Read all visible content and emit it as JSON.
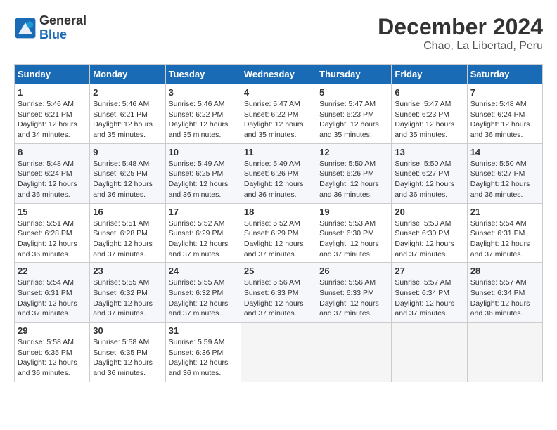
{
  "header": {
    "logo_line1": "General",
    "logo_line2": "Blue",
    "title": "December 2024",
    "subtitle": "Chao, La Libertad, Peru"
  },
  "calendar": {
    "weekdays": [
      "Sunday",
      "Monday",
      "Tuesday",
      "Wednesday",
      "Thursday",
      "Friday",
      "Saturday"
    ],
    "weeks": [
      [
        {
          "day": 1,
          "sunrise": "5:46 AM",
          "sunset": "6:21 PM",
          "daylight": "12 hours and 34 minutes."
        },
        {
          "day": 2,
          "sunrise": "5:46 AM",
          "sunset": "6:21 PM",
          "daylight": "12 hours and 35 minutes."
        },
        {
          "day": 3,
          "sunrise": "5:46 AM",
          "sunset": "6:22 PM",
          "daylight": "12 hours and 35 minutes."
        },
        {
          "day": 4,
          "sunrise": "5:47 AM",
          "sunset": "6:22 PM",
          "daylight": "12 hours and 35 minutes."
        },
        {
          "day": 5,
          "sunrise": "5:47 AM",
          "sunset": "6:23 PM",
          "daylight": "12 hours and 35 minutes."
        },
        {
          "day": 6,
          "sunrise": "5:47 AM",
          "sunset": "6:23 PM",
          "daylight": "12 hours and 35 minutes."
        },
        {
          "day": 7,
          "sunrise": "5:48 AM",
          "sunset": "6:24 PM",
          "daylight": "12 hours and 36 minutes."
        }
      ],
      [
        {
          "day": 8,
          "sunrise": "5:48 AM",
          "sunset": "6:24 PM",
          "daylight": "12 hours and 36 minutes."
        },
        {
          "day": 9,
          "sunrise": "5:48 AM",
          "sunset": "6:25 PM",
          "daylight": "12 hours and 36 minutes."
        },
        {
          "day": 10,
          "sunrise": "5:49 AM",
          "sunset": "6:25 PM",
          "daylight": "12 hours and 36 minutes."
        },
        {
          "day": 11,
          "sunrise": "5:49 AM",
          "sunset": "6:26 PM",
          "daylight": "12 hours and 36 minutes."
        },
        {
          "day": 12,
          "sunrise": "5:50 AM",
          "sunset": "6:26 PM",
          "daylight": "12 hours and 36 minutes."
        },
        {
          "day": 13,
          "sunrise": "5:50 AM",
          "sunset": "6:27 PM",
          "daylight": "12 hours and 36 minutes."
        },
        {
          "day": 14,
          "sunrise": "5:50 AM",
          "sunset": "6:27 PM",
          "daylight": "12 hours and 36 minutes."
        }
      ],
      [
        {
          "day": 15,
          "sunrise": "5:51 AM",
          "sunset": "6:28 PM",
          "daylight": "12 hours and 36 minutes."
        },
        {
          "day": 16,
          "sunrise": "5:51 AM",
          "sunset": "6:28 PM",
          "daylight": "12 hours and 37 minutes."
        },
        {
          "day": 17,
          "sunrise": "5:52 AM",
          "sunset": "6:29 PM",
          "daylight": "12 hours and 37 minutes."
        },
        {
          "day": 18,
          "sunrise": "5:52 AM",
          "sunset": "6:29 PM",
          "daylight": "12 hours and 37 minutes."
        },
        {
          "day": 19,
          "sunrise": "5:53 AM",
          "sunset": "6:30 PM",
          "daylight": "12 hours and 37 minutes."
        },
        {
          "day": 20,
          "sunrise": "5:53 AM",
          "sunset": "6:30 PM",
          "daylight": "12 hours and 37 minutes."
        },
        {
          "day": 21,
          "sunrise": "5:54 AM",
          "sunset": "6:31 PM",
          "daylight": "12 hours and 37 minutes."
        }
      ],
      [
        {
          "day": 22,
          "sunrise": "5:54 AM",
          "sunset": "6:31 PM",
          "daylight": "12 hours and 37 minutes."
        },
        {
          "day": 23,
          "sunrise": "5:55 AM",
          "sunset": "6:32 PM",
          "daylight": "12 hours and 37 minutes."
        },
        {
          "day": 24,
          "sunrise": "5:55 AM",
          "sunset": "6:32 PM",
          "daylight": "12 hours and 37 minutes."
        },
        {
          "day": 25,
          "sunrise": "5:56 AM",
          "sunset": "6:33 PM",
          "daylight": "12 hours and 37 minutes."
        },
        {
          "day": 26,
          "sunrise": "5:56 AM",
          "sunset": "6:33 PM",
          "daylight": "12 hours and 37 minutes."
        },
        {
          "day": 27,
          "sunrise": "5:57 AM",
          "sunset": "6:34 PM",
          "daylight": "12 hours and 37 minutes."
        },
        {
          "day": 28,
          "sunrise": "5:57 AM",
          "sunset": "6:34 PM",
          "daylight": "12 hours and 36 minutes."
        }
      ],
      [
        {
          "day": 29,
          "sunrise": "5:58 AM",
          "sunset": "6:35 PM",
          "daylight": "12 hours and 36 minutes."
        },
        {
          "day": 30,
          "sunrise": "5:58 AM",
          "sunset": "6:35 PM",
          "daylight": "12 hours and 36 minutes."
        },
        {
          "day": 31,
          "sunrise": "5:59 AM",
          "sunset": "6:36 PM",
          "daylight": "12 hours and 36 minutes."
        },
        null,
        null,
        null,
        null
      ]
    ]
  }
}
